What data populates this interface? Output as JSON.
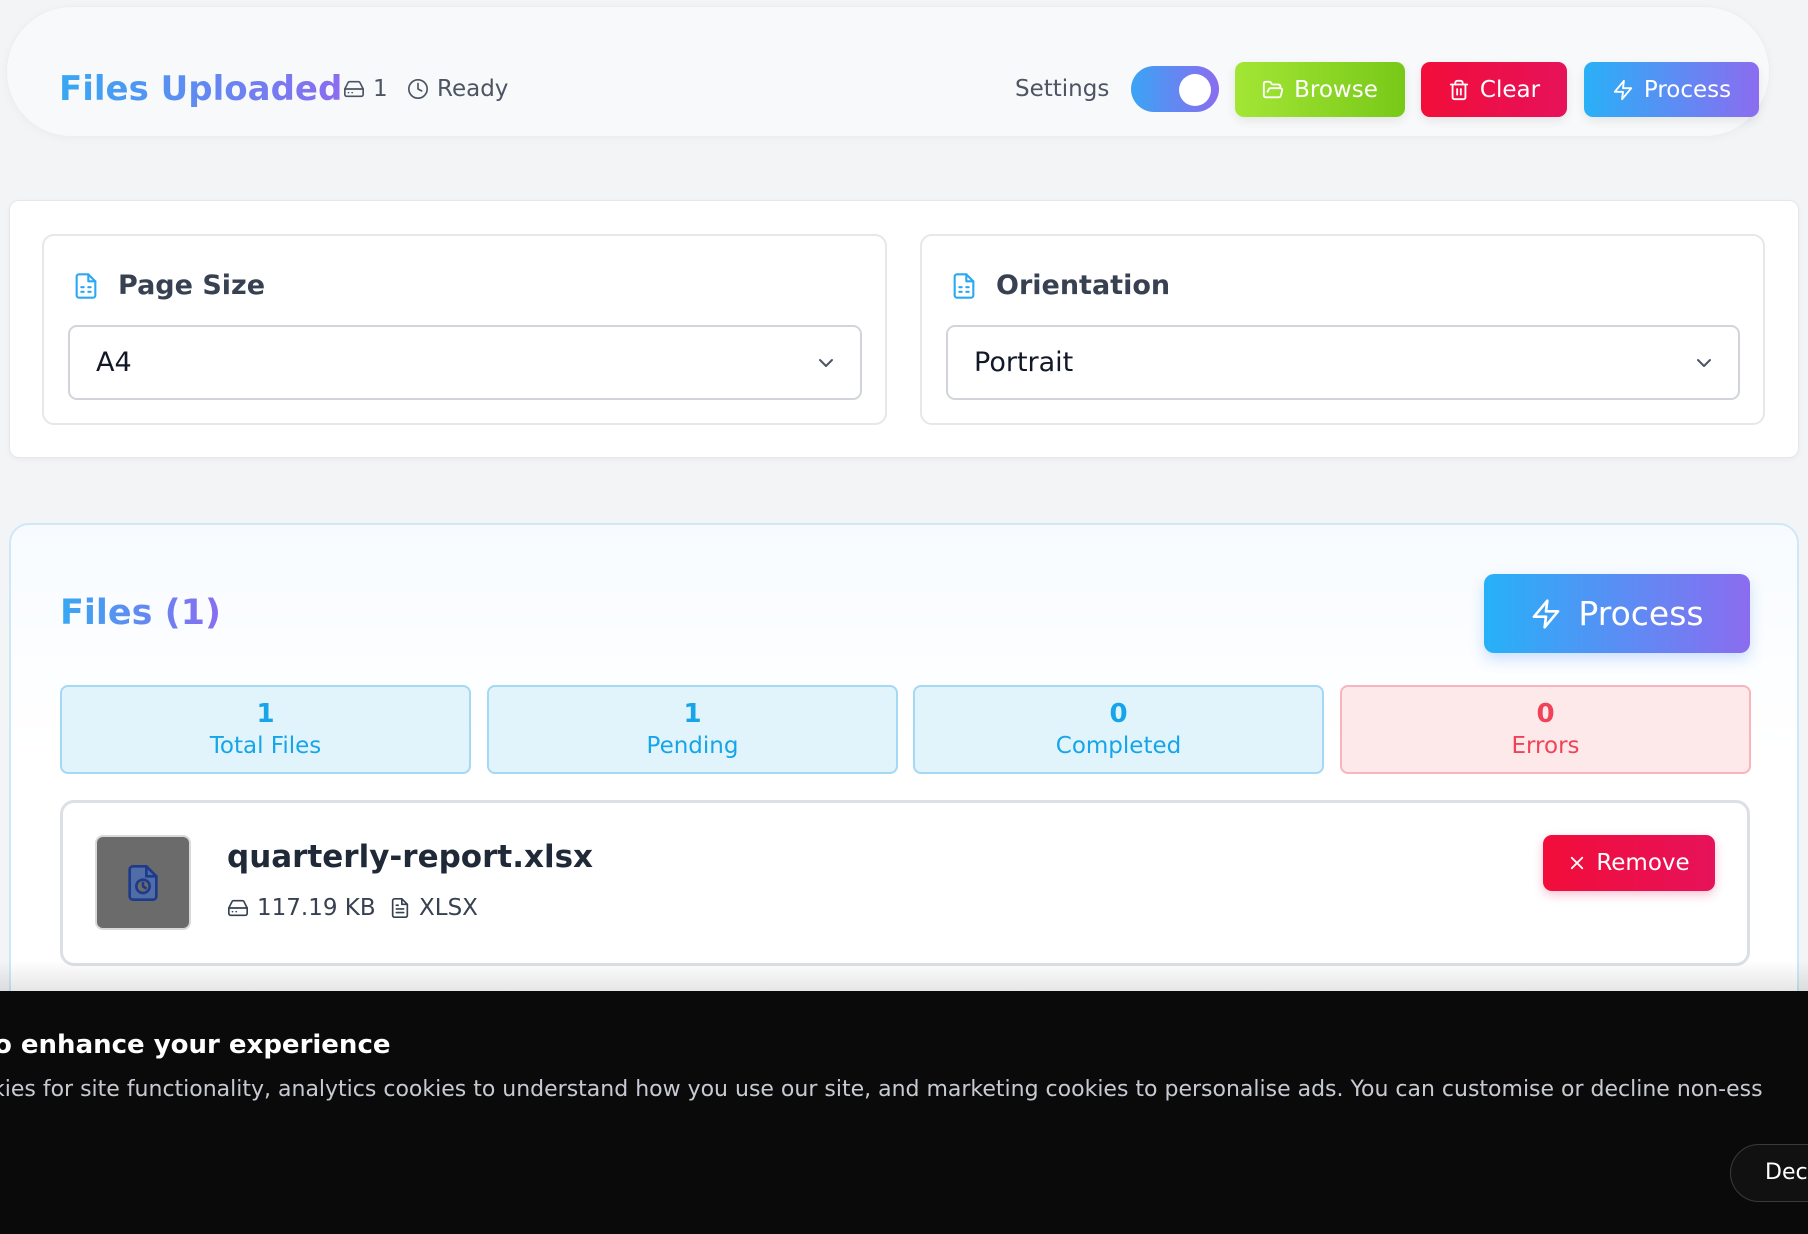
{
  "header": {
    "title": "Files Uploaded",
    "file_count": "1",
    "status": "Ready",
    "settings_label": "Settings",
    "settings_toggle_on": true,
    "browse_label": "Browse",
    "clear_label": "Clear",
    "process_label": "Process"
  },
  "options": {
    "page_size": {
      "label": "Page Size",
      "value": "A4"
    },
    "orientation": {
      "label": "Orientation",
      "value": "Portrait"
    }
  },
  "files": {
    "title": "Files (1)",
    "process_label": "Process",
    "stats": [
      {
        "value": "1",
        "label": "Total Files"
      },
      {
        "value": "1",
        "label": "Pending"
      },
      {
        "value": "0",
        "label": "Completed"
      },
      {
        "value": "0",
        "label": "Errors"
      }
    ],
    "items": [
      {
        "name": "quarterly-report.xlsx",
        "size": "117.19 KB",
        "type": "XLSX",
        "remove_label": "Remove"
      }
    ]
  },
  "cookie": {
    "title": "o enhance your experience",
    "text": "kies for site functionality, analytics cookies to understand how you use our site, and marketing cookies to personalise ads. You can customise or decline non-ess",
    "decline_label": "Dec"
  },
  "colors": {
    "accent_gradient_start": "#29b0f7",
    "accent_gradient_end": "#8b6cf0",
    "browse_green": "#84cc16",
    "danger_red": "#f20d3a",
    "stat_blue": "#16a5e8",
    "error_red": "#f04357",
    "banner_bg": "#0a0a0a"
  },
  "icons": {
    "file_count": "hard-drive-icon",
    "status": "clock-icon",
    "browse": "folder-open-icon",
    "clear": "trash-icon",
    "process": "lightning-icon",
    "options": "document-icon",
    "select": "chevron-down-icon",
    "file_thumb": "file-clock-icon",
    "file_size": "hard-drive-icon",
    "file_type": "file-text-icon",
    "remove": "close-icon"
  }
}
